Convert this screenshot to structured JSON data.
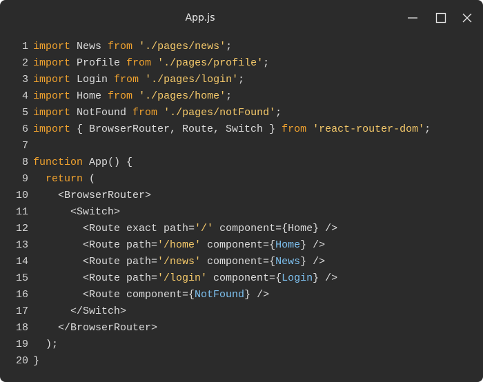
{
  "window": {
    "title": "App.js",
    "controls": [
      "minimize-icon",
      "maximize-icon",
      "close-icon"
    ]
  },
  "colors": {
    "background": "#2b2b2b",
    "keyword": "#f0a22e",
    "string": "#f5c96a",
    "identifier": "#7ec1f0",
    "plain": "#dcdcdc"
  },
  "code": {
    "lines": [
      {
        "num": "1",
        "tokens": [
          {
            "t": "import",
            "c": "kw"
          },
          {
            "t": " News ",
            "c": "pl"
          },
          {
            "t": "from",
            "c": "kw"
          },
          {
            "t": " ",
            "c": "pl"
          },
          {
            "t": "'./pages/news'",
            "c": "str"
          },
          {
            "t": ";",
            "c": "pl"
          }
        ]
      },
      {
        "num": "2",
        "tokens": [
          {
            "t": "import",
            "c": "kw"
          },
          {
            "t": " Profile ",
            "c": "pl"
          },
          {
            "t": "from",
            "c": "kw"
          },
          {
            "t": " ",
            "c": "pl"
          },
          {
            "t": "'./pages/profile'",
            "c": "str"
          },
          {
            "t": ";",
            "c": "pl"
          }
        ]
      },
      {
        "num": "3",
        "tokens": [
          {
            "t": "import",
            "c": "kw"
          },
          {
            "t": " Login ",
            "c": "pl"
          },
          {
            "t": "from",
            "c": "kw"
          },
          {
            "t": " ",
            "c": "pl"
          },
          {
            "t": "'./pages/login'",
            "c": "str"
          },
          {
            "t": ";",
            "c": "pl"
          }
        ]
      },
      {
        "num": "4",
        "tokens": [
          {
            "t": "import",
            "c": "kw"
          },
          {
            "t": " Home ",
            "c": "pl"
          },
          {
            "t": "from",
            "c": "kw"
          },
          {
            "t": " ",
            "c": "pl"
          },
          {
            "t": "'./pages/home'",
            "c": "str"
          },
          {
            "t": ";",
            "c": "pl"
          }
        ]
      },
      {
        "num": "5",
        "tokens": [
          {
            "t": "import",
            "c": "kw"
          },
          {
            "t": " NotFound ",
            "c": "pl"
          },
          {
            "t": "from",
            "c": "kw"
          },
          {
            "t": " ",
            "c": "pl"
          },
          {
            "t": "'./pages/notFound'",
            "c": "str"
          },
          {
            "t": ";",
            "c": "pl"
          }
        ]
      },
      {
        "num": "6",
        "tokens": [
          {
            "t": "import",
            "c": "kw"
          },
          {
            "t": " { BrowserRouter, Route, Switch } ",
            "c": "pl"
          },
          {
            "t": "from",
            "c": "kw"
          },
          {
            "t": " ",
            "c": "pl"
          },
          {
            "t": "'react-router-dom'",
            "c": "str"
          },
          {
            "t": ";",
            "c": "pl"
          }
        ]
      },
      {
        "num": "7",
        "tokens": []
      },
      {
        "num": "8",
        "tokens": [
          {
            "t": "function",
            "c": "kw"
          },
          {
            "t": " App() {",
            "c": "pl"
          }
        ]
      },
      {
        "num": "9",
        "tokens": [
          {
            "t": "  ",
            "c": "pl"
          },
          {
            "t": "return",
            "c": "kw"
          },
          {
            "t": " (",
            "c": "pl"
          }
        ]
      },
      {
        "num": "10",
        "tokens": [
          {
            "t": "    <BrowserRouter>",
            "c": "pl"
          }
        ]
      },
      {
        "num": "11",
        "tokens": [
          {
            "t": "      <Switch>",
            "c": "pl"
          }
        ]
      },
      {
        "num": "12",
        "tokens": [
          {
            "t": "        <Route exact path=",
            "c": "pl"
          },
          {
            "t": "'/'",
            "c": "str"
          },
          {
            "t": " component={Home} />",
            "c": "pl"
          }
        ]
      },
      {
        "num": "13",
        "tokens": [
          {
            "t": "        <Route path=",
            "c": "pl"
          },
          {
            "t": "'/home'",
            "c": "str"
          },
          {
            "t": " component={",
            "c": "pl"
          },
          {
            "t": "Home",
            "c": "id"
          },
          {
            "t": "} />",
            "c": "pl"
          }
        ]
      },
      {
        "num": "14",
        "tokens": [
          {
            "t": "        <Route path=",
            "c": "pl"
          },
          {
            "t": "'/news'",
            "c": "str"
          },
          {
            "t": " component={",
            "c": "pl"
          },
          {
            "t": "News",
            "c": "id"
          },
          {
            "t": "} />",
            "c": "pl"
          }
        ]
      },
      {
        "num": "15",
        "tokens": [
          {
            "t": "        <Route path=",
            "c": "pl"
          },
          {
            "t": "'/login'",
            "c": "str"
          },
          {
            "t": " component={",
            "c": "pl"
          },
          {
            "t": "Login",
            "c": "id"
          },
          {
            "t": "} />",
            "c": "pl"
          }
        ]
      },
      {
        "num": "16",
        "tokens": [
          {
            "t": "        <Route component={",
            "c": "pl"
          },
          {
            "t": "NotFound",
            "c": "id"
          },
          {
            "t": "} />",
            "c": "pl"
          }
        ]
      },
      {
        "num": "17",
        "tokens": [
          {
            "t": "      </Switch>",
            "c": "pl"
          }
        ]
      },
      {
        "num": "18",
        "tokens": [
          {
            "t": "    </BrowserRouter>",
            "c": "pl"
          }
        ]
      },
      {
        "num": "19",
        "tokens": [
          {
            "t": "  );",
            "c": "pl"
          }
        ]
      },
      {
        "num": "20",
        "tokens": [
          {
            "t": "}",
            "c": "pl"
          }
        ]
      }
    ]
  }
}
